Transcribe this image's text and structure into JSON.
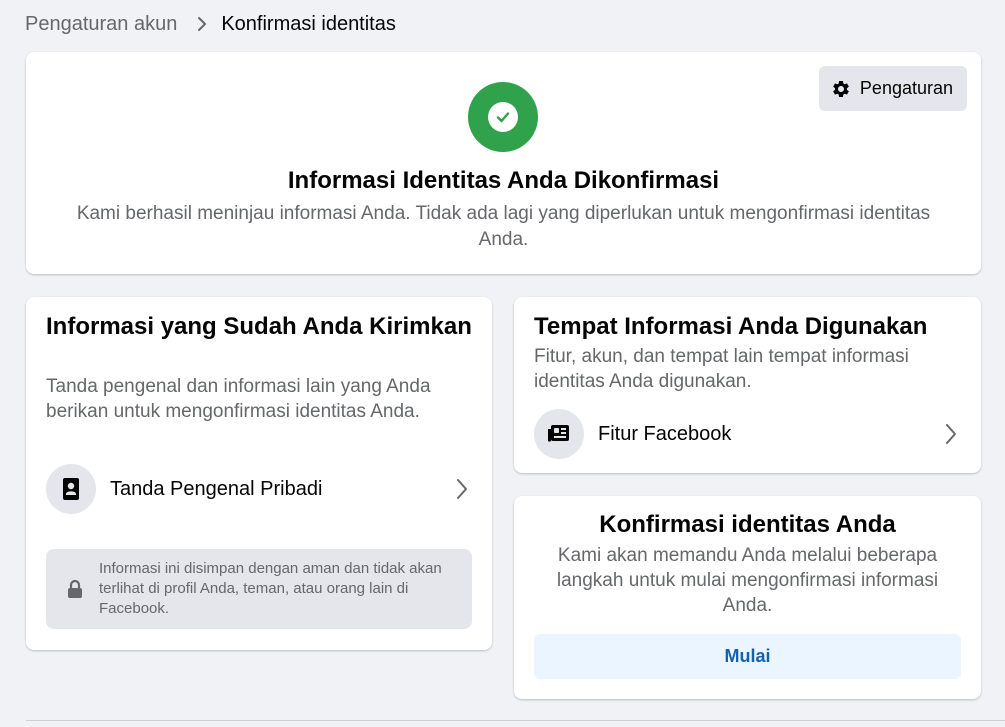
{
  "breadcrumb": {
    "parent": "Pengaturan akun",
    "current": "Konfirmasi identitas"
  },
  "status_card": {
    "settings_label": "Pengaturan",
    "title": "Informasi Identitas Anda Dikonfirmasi",
    "description": "Kami berhasil meninjau informasi Anda. Tidak ada lagi yang diperlukan untuk mengonfirmasi identitas Anda."
  },
  "submitted_card": {
    "title": "Informasi yang Sudah Anda Kirimkan",
    "description": "Tanda pengenal dan informasi lain yang Anda berikan untuk mengonfirmasi identitas Anda.",
    "item_label": "Tanda Pengenal Pribadi",
    "privacy_note": "Informasi ini disimpan dengan aman dan tidak akan terlihat di profil Anda, teman, atau orang lain di Facebook."
  },
  "usage_card": {
    "title": "Tempat Informasi Anda Digunakan",
    "description": "Fitur, akun, dan tempat lain tempat informasi identitas Anda digunakan.",
    "item_label": "Fitur Facebook"
  },
  "confirm_card": {
    "title": "Konfirmasi identitas Anda",
    "description": "Kami akan memandu Anda melalui beberapa langkah untuk mulai mengonfirmasi informasi Anda.",
    "button_label": "Mulai"
  },
  "colors": {
    "success": "#31a24c",
    "link_blue": "#1660b0",
    "button_bg": "#ebf5ff",
    "page_bg": "#f0f2f5"
  },
  "icons": {
    "breadcrumb_separator": "chevron-right-icon",
    "settings": "gear-icon",
    "status": "check-circle-icon",
    "personal_id": "id-badge-icon",
    "facebook_features": "news-feed-icon",
    "row_chevron": "chevron-right-icon",
    "privacy": "lock-icon"
  }
}
